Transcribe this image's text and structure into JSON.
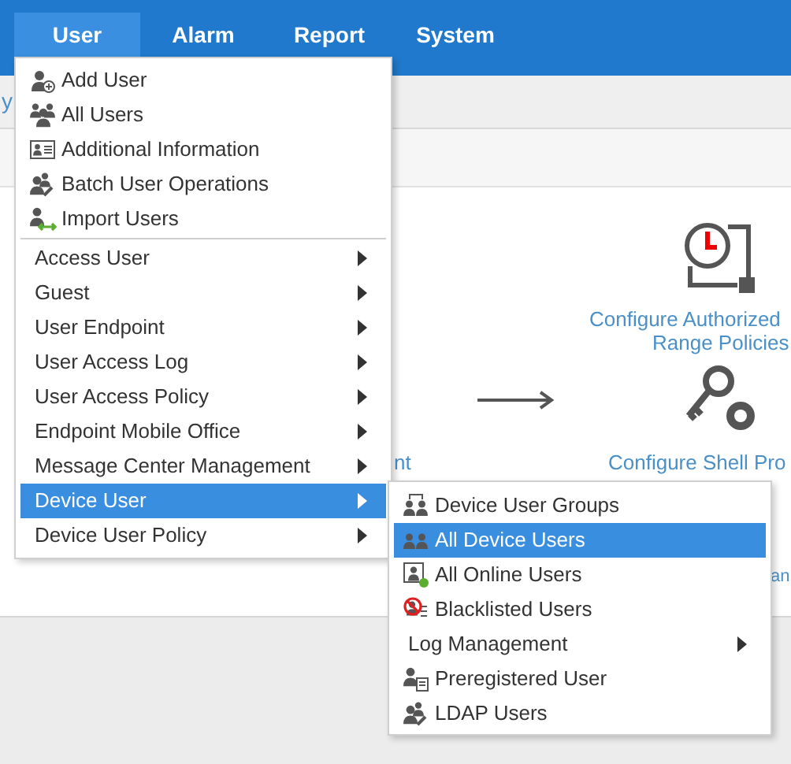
{
  "nav": {
    "tabs": [
      {
        "label": "User",
        "selected": true
      },
      {
        "label": "Alarm",
        "selected": false
      },
      {
        "label": "Report",
        "selected": false
      },
      {
        "label": "System",
        "selected": false
      }
    ]
  },
  "breadcrumb": {
    "fragment": "y"
  },
  "background": {
    "texts": [
      {
        "kind": "link_left",
        "text": "nt"
      },
      {
        "kind": "auth_title",
        "text": "Configure Authorized"
      },
      {
        "kind": "auth_sub",
        "text": "Range Policies"
      },
      {
        "kind": "shell_title",
        "text": "Configure Shell Pro"
      },
      {
        "kind": "cut_right",
        "text": "an"
      }
    ]
  },
  "menu": {
    "items": [
      {
        "label": "Add User",
        "kind": "action",
        "selected": false
      },
      {
        "label": "All Users",
        "kind": "action",
        "selected": false
      },
      {
        "label": "Additional Information",
        "kind": "action",
        "selected": false
      },
      {
        "label": "Batch User Operations",
        "kind": "action",
        "selected": false
      },
      {
        "label": "Import Users",
        "kind": "action",
        "selected": false
      },
      {
        "label": "Access User",
        "kind": "submenu",
        "selected": false
      },
      {
        "label": "Guest",
        "kind": "submenu",
        "selected": false
      },
      {
        "label": "User Endpoint",
        "kind": "submenu",
        "selected": false
      },
      {
        "label": "User Access Log",
        "kind": "submenu",
        "selected": false
      },
      {
        "label": "User Access Policy",
        "kind": "submenu",
        "selected": false
      },
      {
        "label": "Endpoint Mobile Office",
        "kind": "submenu",
        "selected": false
      },
      {
        "label": "Message Center Management",
        "kind": "submenu",
        "selected": false
      },
      {
        "label": "Device User",
        "kind": "submenu",
        "selected": true
      },
      {
        "label": "Device User Policy",
        "kind": "submenu",
        "selected": false
      }
    ]
  },
  "submenu": {
    "items": [
      {
        "label": "Device User Groups",
        "kind": "action",
        "selected": false
      },
      {
        "label": "All Device Users",
        "kind": "action",
        "selected": true
      },
      {
        "label": "All Online Users",
        "kind": "action",
        "selected": false
      },
      {
        "label": "Blacklisted Users",
        "kind": "action",
        "selected": false
      },
      {
        "label": "Log Management",
        "kind": "submenu",
        "selected": false
      },
      {
        "label": "Preregistered User",
        "kind": "action",
        "selected": false
      },
      {
        "label": "LDAP Users",
        "kind": "action",
        "selected": false
      }
    ]
  }
}
